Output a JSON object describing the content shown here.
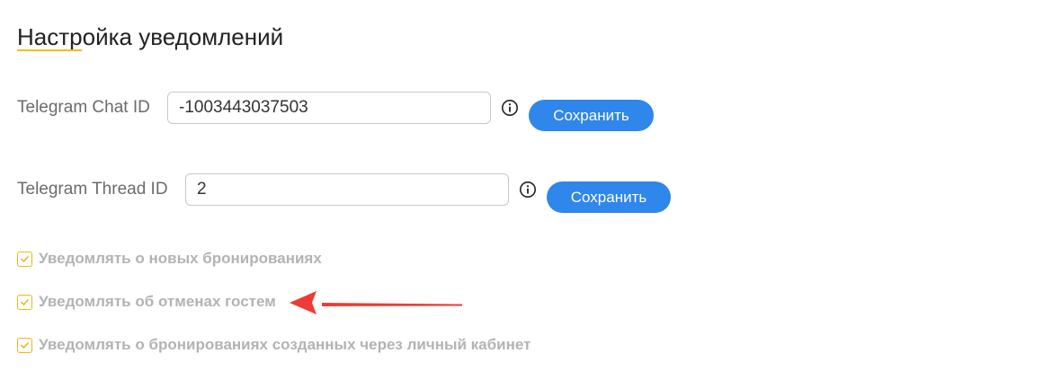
{
  "page": {
    "title": "Настройка уведомлений"
  },
  "chat_id": {
    "label": "Telegram Chat ID",
    "value": "-1003443037503",
    "info_icon": "info-icon",
    "save_label": "Сохранить"
  },
  "thread_id": {
    "label": "Telegram Thread ID",
    "value": "2",
    "info_icon": "info-icon",
    "save_label": "Сохранить"
  },
  "notifications": [
    {
      "label": "Уведомлять о новых бронированиях",
      "checked": true
    },
    {
      "label": "Уведомлять об отменах гостем",
      "checked": true
    },
    {
      "label": "Уведомлять о бронированиях созданных через личный кабинет",
      "checked": true
    }
  ],
  "colors": {
    "accent_yellow": "#f2b514",
    "button_blue": "#2f86eb",
    "annotation_red": "#f03a35"
  }
}
